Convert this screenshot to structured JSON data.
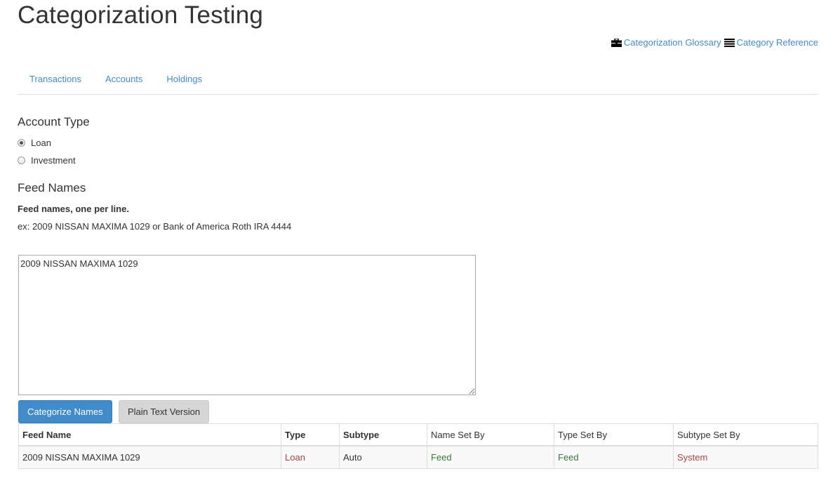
{
  "page": {
    "title": "Categorization Testing"
  },
  "links": {
    "glossary": "Categorization Glossary",
    "reference": "Category Reference"
  },
  "tabs": [
    "Transactions",
    "Accounts",
    "Holdings"
  ],
  "account_type": {
    "heading": "Account Type",
    "options": [
      {
        "label": "Loan",
        "checked": true
      },
      {
        "label": "Investment",
        "checked": false
      }
    ]
  },
  "feed_names": {
    "heading": "Feed Names",
    "help_bold": "Feed names, one per line.",
    "help_example": "ex: 2009 NISSAN MAXIMA 1029 or Bank of America Roth IRA 4444",
    "value": "2009 NISSAN MAXIMA 1029"
  },
  "buttons": {
    "categorize": "Categorize Names",
    "plain_text": "Plain Text Version"
  },
  "table": {
    "headers": [
      "Feed Name",
      "Type",
      "Subtype",
      "Name Set By",
      "Type Set By",
      "Subtype Set By"
    ],
    "rows": [
      [
        "2009 NISSAN MAXIMA 1029",
        "Loan",
        "Auto",
        "Feed",
        "Feed",
        "System"
      ]
    ]
  },
  "colors": {
    "link": "#428bca",
    "primary_button": "#428bca",
    "status_red": "#a94442",
    "status_green": "#3c763d"
  }
}
